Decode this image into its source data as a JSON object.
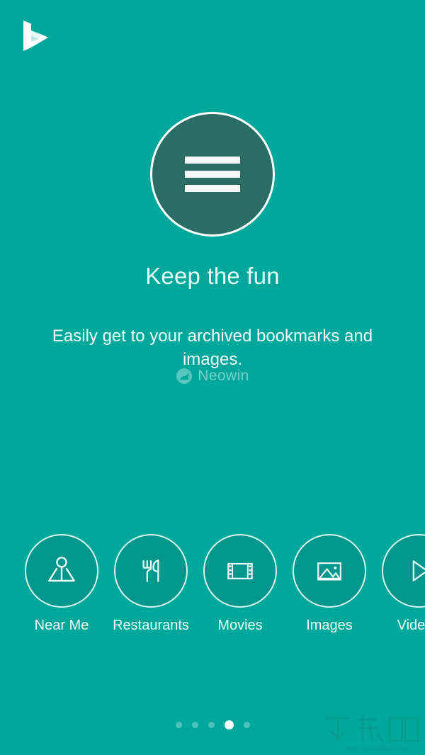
{
  "app": {
    "name": "Bing",
    "logo_icon": "bing-logo-icon",
    "background_color": "#00a89c",
    "accent_circle_color": "#2b6c64",
    "text_color": "#eafaf7"
  },
  "hero": {
    "icon": "hamburger-menu-icon",
    "headline": "Keep the fun",
    "subtitle": "Easily get to your archived bookmarks and images."
  },
  "watermarks": {
    "neowin": {
      "text": "Neowin",
      "icon": "neowin-logo-icon"
    },
    "xiazaiba": {
      "text": "下载吧",
      "url": "www.xiazaiba.com"
    }
  },
  "shortcuts": [
    {
      "label": "Near Me",
      "icon": "near-me-icon"
    },
    {
      "label": "Restaurants",
      "icon": "restaurants-icon"
    },
    {
      "label": "Movies",
      "icon": "movies-filmstrip-icon"
    },
    {
      "label": "Images",
      "icon": "images-picture-icon"
    },
    {
      "label": "Videos",
      "icon": "videos-play-icon"
    }
  ],
  "pagination": {
    "total": 5,
    "active_index": 3
  }
}
